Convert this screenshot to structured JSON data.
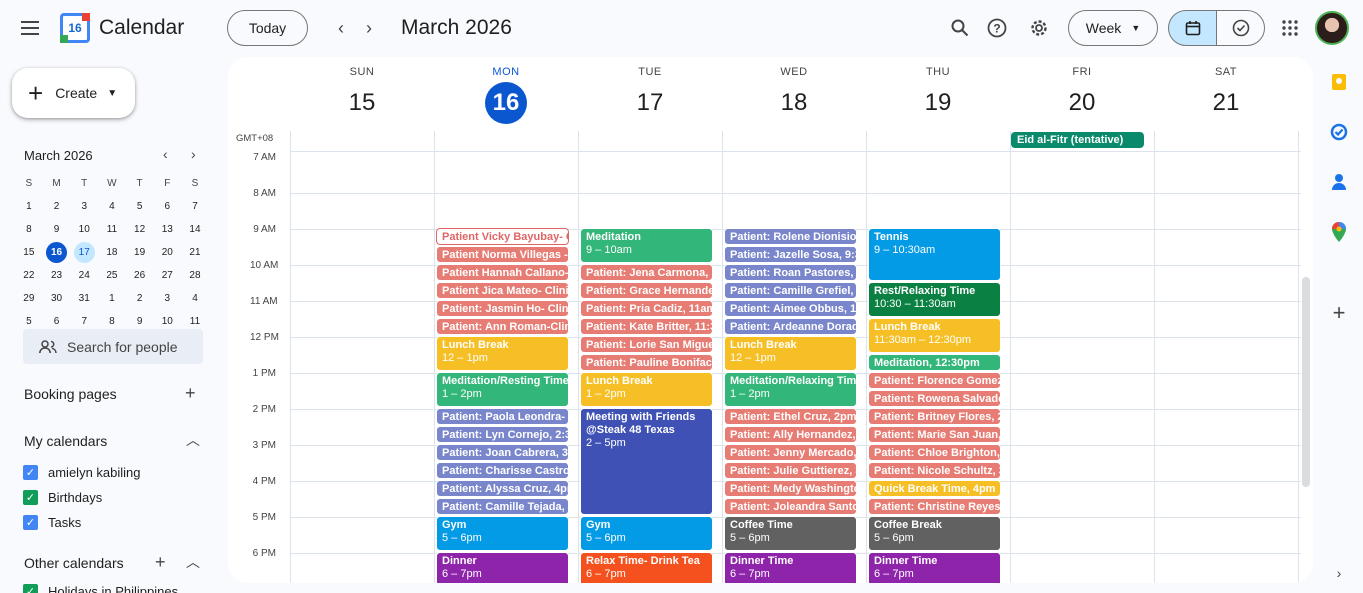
{
  "app": {
    "name": "Calendar",
    "logo_day": "16"
  },
  "toolbar": {
    "today_label": "Today",
    "date_range": "March 2026",
    "view_label": "Week",
    "prev_arrow": "‹",
    "next_arrow": "›"
  },
  "sidebar": {
    "create_label": "Create",
    "mini_month": "March 2026",
    "mini_days_header": [
      "S",
      "M",
      "T",
      "W",
      "T",
      "F",
      "S"
    ],
    "mini_weeks": [
      [
        "1",
        "2",
        "3",
        "4",
        "5",
        "6",
        "7"
      ],
      [
        "8",
        "9",
        "10",
        "11",
        "12",
        "13",
        "14"
      ],
      [
        "15",
        "16",
        "17",
        "18",
        "19",
        "20",
        "21"
      ],
      [
        "22",
        "23",
        "24",
        "25",
        "26",
        "27",
        "28"
      ],
      [
        "29",
        "30",
        "31",
        "1",
        "2",
        "3",
        "4"
      ],
      [
        "5",
        "6",
        "7",
        "8",
        "9",
        "10",
        "11"
      ]
    ],
    "search_people_placeholder": "Search for people",
    "booking_pages": "Booking pages",
    "my_calendars": "My calendars",
    "calendars": [
      {
        "name": "amielyn kabiling",
        "color": "#4285f4"
      },
      {
        "name": "Birthdays",
        "color": "#0f9d58"
      },
      {
        "name": "Tasks",
        "color": "#4285f4"
      }
    ],
    "other_calendars": "Other calendars",
    "other_calendar_partial": "Holidays in Philippines"
  },
  "week": {
    "timezone": "GMT+08",
    "days": [
      {
        "dow": "SUN",
        "num": "15"
      },
      {
        "dow": "MON",
        "num": "16"
      },
      {
        "dow": "TUE",
        "num": "17"
      },
      {
        "dow": "WED",
        "num": "18"
      },
      {
        "dow": "THU",
        "num": "19"
      },
      {
        "dow": "FRI",
        "num": "20"
      },
      {
        "dow": "SAT",
        "num": "21"
      }
    ],
    "hours": [
      "7 AM",
      "8 AM",
      "9 AM",
      "10 AM",
      "11 AM",
      "12 PM",
      "1 PM",
      "2 PM",
      "3 PM",
      "4 PM",
      "5 PM",
      "6 PM"
    ],
    "allday_event": "Eid al-Fitr (tentative)"
  },
  "events": {
    "mon": [
      "Patient Vicky Bayubay- C",
      "Patient Norma Villegas -C",
      "Patient Hannah Callano-",
      "Patient Jica Mateo- Clini",
      "Patient: Jasmin Ho- Clini",
      "Patient: Ann Roman-Clin",
      {
        "title": "Lunch Break",
        "time": "12 – 1pm"
      },
      {
        "title": "Meditation/Resting Time",
        "time": "1 – 2pm"
      },
      "Patient: Paola Leondra- C",
      "Patient: Lyn Cornejo, 2:3",
      "Patient: Joan Cabrera, 3p",
      "Patient: Charisse Castro,",
      "Patient: Alyssa Cruz, 4pm",
      "Patient: Camille Tejada, 4",
      {
        "title": "Gym",
        "time": "5 – 6pm"
      },
      {
        "title": "Dinner",
        "time": "6 – 7pm"
      }
    ],
    "tue": [
      {
        "title": "Meditation",
        "time": "9 – 10am"
      },
      "Patient: Jena Carmona, 1",
      "Patient: Grace Hernande",
      "Patient: Pria Cadiz, 11am",
      "Patient: Kate Britter, 11:3",
      "Patient: Lorie San Migue",
      "Patient: Pauline Bonifacio",
      {
        "title": "Lunch Break",
        "time": "1 – 2pm"
      },
      {
        "title": "Meeting with Friends @Steak 48 Texas",
        "time": "2 – 5pm"
      },
      {
        "title": "Gym",
        "time": "5 – 6pm"
      },
      {
        "title": "Relax Time- Drink Tea",
        "time": "6 – 7pm"
      }
    ],
    "wed": [
      "Patient: Rolene Dionisio,",
      "Patient: Jazelle Sosa, 9:3",
      "Patient: Roan Pastores, 1",
      "Patient: Camille Grefiel, 1",
      "Patient: Aimee Obbus, 11",
      "Patient: Ardeanne Dorad",
      {
        "title": "Lunch Break",
        "time": "12 – 1pm"
      },
      {
        "title": "Meditation/Relaxing Time",
        "time": "1 – 2pm"
      },
      "Patient: Ethel Cruz, 2pm",
      "Patient: Ally Hernandez,",
      "Patient: Jenny Mercado,",
      "Patient: Julie Guttierez, 3",
      "Patient: Medy Washingto",
      "Patient: Joleandra Santo",
      {
        "title": "Coffee Time",
        "time": "5 – 6pm"
      },
      {
        "title": "Dinner Time",
        "time": "6 – 7pm"
      }
    ],
    "thu": [
      {
        "title": "Tennis",
        "time": "9 – 10:30am"
      },
      {
        "title": "Rest/Relaxing Time",
        "time": "10:30 – 11:30am"
      },
      {
        "title": "Lunch Break",
        "time": "11:30am – 12:30pm"
      },
      "Meditation, 12:30pm",
      "Patient: Florence Gomez",
      "Patient: Rowena Salvado",
      "Patient: Britney Flores, 2",
      "Patient: Marie San Juan,",
      "Patient: Chloe Brighton,",
      "Patient: Nicole Schultz, 3",
      "Quick Break Time, 4pm",
      "Patient: Christine Reyes,",
      {
        "title": "Coffee Break",
        "time": "5 – 6pm"
      },
      {
        "title": "Dinner Time",
        "time": "6 – 7pm"
      }
    ]
  },
  "colors": {
    "patient": "#e67c73",
    "blue": "#7986cb",
    "yellow": "#f6bf26",
    "green": "#33b679",
    "sky": "#039be5",
    "darkgreen": "#0b8043",
    "indigo": "#3f51b5",
    "orange": "#f4511e",
    "purple": "#8e24aa",
    "graphite": "#616161",
    "today": "#0b57d0"
  }
}
